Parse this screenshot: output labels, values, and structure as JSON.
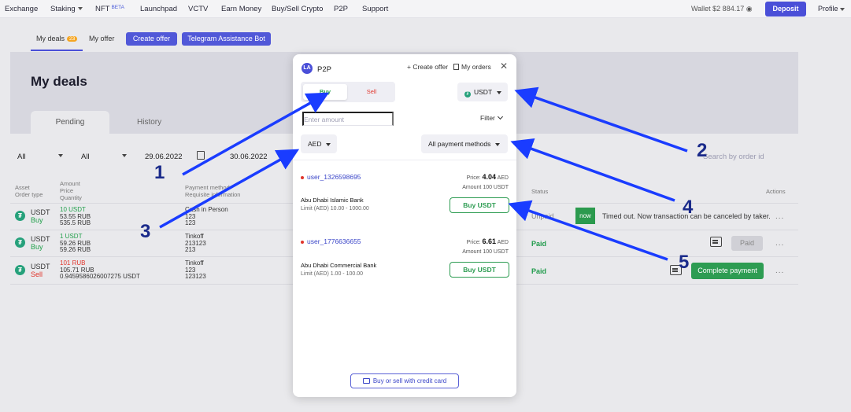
{
  "nav": {
    "items": [
      "Exchange",
      "Staking",
      "NFT",
      "Launchpad",
      "VCTV",
      "Earn Money",
      "Buy/Sell Crypto",
      "P2P",
      "Support"
    ],
    "nft_beta": "BETA",
    "wallet": "Wallet $2 884.17",
    "deposit": "Deposit",
    "profile": "Profile"
  },
  "subnav": {
    "my_deals": "My deals",
    "my_deals_count": "23",
    "my_offer": "My offer",
    "create_offer": "Create offer",
    "telegram_bot": "Telegram Assistance Bot"
  },
  "page": {
    "title": "My deals",
    "tab_pending": "Pending",
    "tab_history": "History"
  },
  "filters": {
    "filter1": "All",
    "filter2": "All",
    "date_from": "29.06.2022",
    "date_to": "30.06.2022",
    "search_placeholder": "Search by order id"
  },
  "table": {
    "headers": {
      "asset": "Asset",
      "order_type": "Order type",
      "amount": "Amount",
      "price": "Price",
      "quantity": "Quantity",
      "payment": "Payment method",
      "requisite": "Requisite information",
      "status": "Status",
      "actions": "Actions"
    },
    "rows": [
      {
        "asset": "USDT",
        "type": "Buy",
        "amount": "10 USDT",
        "price": "53.55 RUB",
        "quantity": "535.5 RUB",
        "pay1": "Cash in Person",
        "pay2": "123",
        "pay3": "123",
        "status": "Unpaid",
        "now": "now",
        "note": "Timed out. Now transaction can be canceled by taker."
      },
      {
        "asset": "USDT",
        "type": "Buy",
        "amount": "1 USDT",
        "price": "59.26 RUB",
        "quantity": "59.26 RUB",
        "pay1": "Tinkoff",
        "pay2": "213123",
        "pay3": "213",
        "status": "Paid",
        "action": "Paid"
      },
      {
        "asset": "USDT",
        "type": "Sell",
        "amount": "101 RUB",
        "price": "105.71 RUB",
        "quantity": "0.9459586026007275 USDT",
        "pay1": "Tinkoff",
        "pay2": "123",
        "pay3": "123123",
        "status": "Paid",
        "action": "Complete payment"
      }
    ],
    "more": "..."
  },
  "modal": {
    "title": "P2P",
    "logo": "LA",
    "create_offer": "+ Create offer",
    "my_orders": "My orders",
    "close": "✕",
    "buy": "Buy",
    "sell": "Sell",
    "currency": "USDT",
    "amount_placeholder": "Enter amount",
    "filter": "Filter",
    "fiat": "AED",
    "payment_methods": "All payment methods",
    "offers": [
      {
        "user": "user_1326598695",
        "price_label": "Price:",
        "price": "4.04",
        "price_cur": "AED",
        "amount_label": "Amount",
        "amount": "100 USDT",
        "bank": "Abu Dhabi Islamic Bank",
        "limit": "Limit (AED) 10.00 - 1000.00",
        "button": "Buy USDT"
      },
      {
        "user": "user_1776636655",
        "price_label": "Price:",
        "price": "6.61",
        "price_cur": "AED",
        "amount_label": "Amount",
        "amount": "100 USDT",
        "bank": "Abu Dhabi Commercial Bank",
        "limit": "Limit (AED) 1.00 - 100.00",
        "button": "Buy USDT"
      }
    ],
    "card_button": "Buy or sell with credit card"
  },
  "annotations": [
    "1",
    "2",
    "3",
    "4",
    "5"
  ],
  "colors": {
    "accent": "#4a4fd8",
    "buy": "#22a04b",
    "sell": "#e0352b",
    "arrow": "#1a3cff"
  }
}
